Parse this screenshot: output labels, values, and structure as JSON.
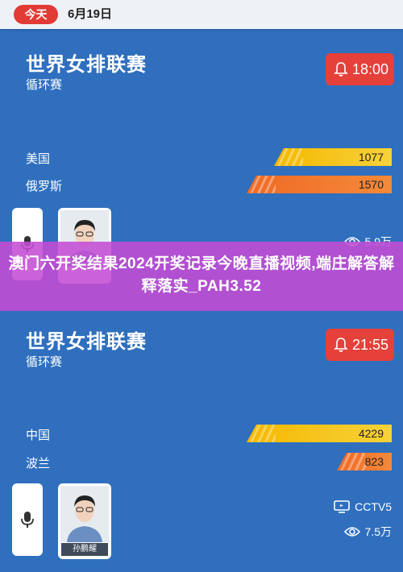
{
  "header": {
    "today": "今天",
    "date": "6月19日"
  },
  "matches": [
    {
      "title": "世界女排联赛",
      "subtitle": "循环赛",
      "time": "18:00",
      "teams": [
        {
          "name": "美国",
          "votes": "1077",
          "color": "#f5b800"
        },
        {
          "name": "俄罗斯",
          "votes": "1570",
          "color": "#ef6a25"
        }
      ],
      "views": "5.9万"
    },
    {
      "title": "世界女排联赛",
      "subtitle": "循环赛",
      "time": "21:55",
      "teams": [
        {
          "name": "中国",
          "votes": "4229",
          "color": "#f5b800"
        },
        {
          "name": "波兰",
          "votes": "823",
          "color": "#ef6a25"
        }
      ],
      "channel": "CCTV5",
      "commentator": "孙鹏耀",
      "views": "7.5万"
    }
  ],
  "overlay": {
    "text": "澳门六开奖结果2024开奖记录今晚直播视频,端庄解答解释落实_PAH3.52"
  },
  "colors": {
    "background": "#2f6fbe",
    "time_pill": "#e5403a",
    "today_pill": "#e23a34",
    "overlay": "#c44cd4"
  }
}
